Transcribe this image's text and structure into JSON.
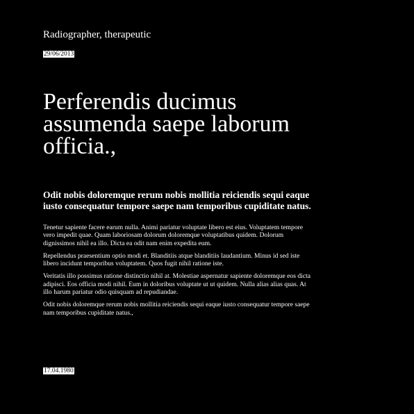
{
  "header": {
    "title": "Radiographer, therapeutic",
    "date": "29/06/2013"
  },
  "headline": "Perferendis ducimus assumenda saepe laborum officia.,",
  "subheading": "Odit nobis doloremque rerum nobis mollitia reiciendis sequi eaque iusto consequatur tempore saepe nam temporibus cupiditate natus.",
  "paragraphs": [
    "Tenetur sapiente facere earum nulla. Animi pariatur voluptate libero est eius. Voluptatem tempore vero impedit quae. Quam laboriosam dolorum doloremque voluptatibus quidem. Dolorum dignissimos nihil ea illo. Dicta ea odit nam enim expedita eum.",
    "Repellendus praesentium optio modi et. Blanditiis atque blanditiis laudantium. Minus id sed iste libero incidunt temporibus voluptatem. Quos fugit nihil ratione iste.",
    "Veritatis illo possimus ratione distinctio nihil at. Molestiae aspernatur sapiente doloremque eos dicta adipisci. Eos officia modi nihil. Eum in doloribus voluptate ut ut quidem. Nulla alias alias quas. At illo harum pariatur odio quisquam ad repudiandae.",
    "Odit nobis doloremque rerum nobis mollitia reiciendis sequi eaque iusto consequatur tempore saepe nam temporibus cupiditate natus.,"
  ],
  "footer": {
    "date": "17.04.1980"
  }
}
